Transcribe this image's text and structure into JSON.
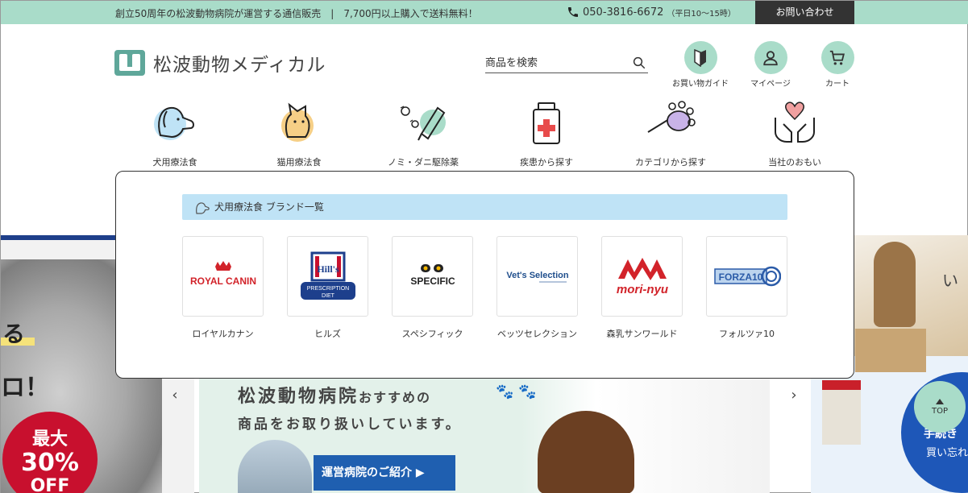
{
  "topbar": {
    "message": "創立50周年の松波動物病院が運営する通信販売　|　7,700円以上購入で送料無料！",
    "phone": "050-3816-6672",
    "hours": "（平日10〜15時）",
    "contact_label": "お問い合わせ"
  },
  "logo": {
    "name": "松波動物メディカル"
  },
  "search": {
    "placeholder": "商品を検索"
  },
  "header_icons": [
    {
      "label": "お買い物ガイド",
      "icon": "beginner-leaf-icon"
    },
    {
      "label": "マイページ",
      "icon": "user-icon"
    },
    {
      "label": "カート",
      "icon": "cart-icon"
    }
  ],
  "categories": [
    {
      "label": "犬用療法食",
      "icon": "dog-icon"
    },
    {
      "label": "猫用療法食",
      "icon": "cat-icon"
    },
    {
      "label": "ノミ・ダニ駆除薬",
      "icon": "flea-tick-icon"
    },
    {
      "label": "疾患から探す",
      "icon": "medicine-bottle-icon"
    },
    {
      "label": "カテゴリから探す",
      "icon": "paw-icon"
    },
    {
      "label": "当社のおもい",
      "icon": "heart-hands-icon"
    }
  ],
  "dropdown": {
    "heading": "犬用療法食 ブランド一覧",
    "brands": [
      {
        "name": "ロイヤルカナン",
        "logo_text": "ROYAL CANIN"
      },
      {
        "name": "ヒルズ",
        "logo_text": "Hill's",
        "logo_sub1": "PRESCRIPTION",
        "logo_sub2": "DIET"
      },
      {
        "name": "スペシフィック",
        "logo_text": "SPECIFIC"
      },
      {
        "name": "ベッツセレクション",
        "logo_text": "Vet's Selection"
      },
      {
        "name": "森乳サンワールド",
        "logo_text": "mori-nyu"
      },
      {
        "name": "フォルツァ10",
        "logo_text": "FORZA10"
      }
    ]
  },
  "left_banner": {
    "text_a": "る",
    "text_b": "ロ！",
    "sale_a": "最大",
    "sale_b": "30%",
    "sale_c": "OFF"
  },
  "main_banner": {
    "title_main": "松波動物病院",
    "title_small": "おすすめの",
    "subtitle": "商品をお取り扱いしています。",
    "cta": "運営病院のご紹介 ▶"
  },
  "right_banner": {
    "text_i": "い",
    "text_k1": "手続き",
    "text_k2": "買い忘れ"
  },
  "carousel": {
    "prev": "‹",
    "next": "›"
  },
  "top_button": {
    "label": "TOP"
  },
  "colors": {
    "accent": "#a9dcc9",
    "dark": "#333333",
    "dropdown_head": "#bfe3f6",
    "brand_blue": "#1f5fb0"
  }
}
